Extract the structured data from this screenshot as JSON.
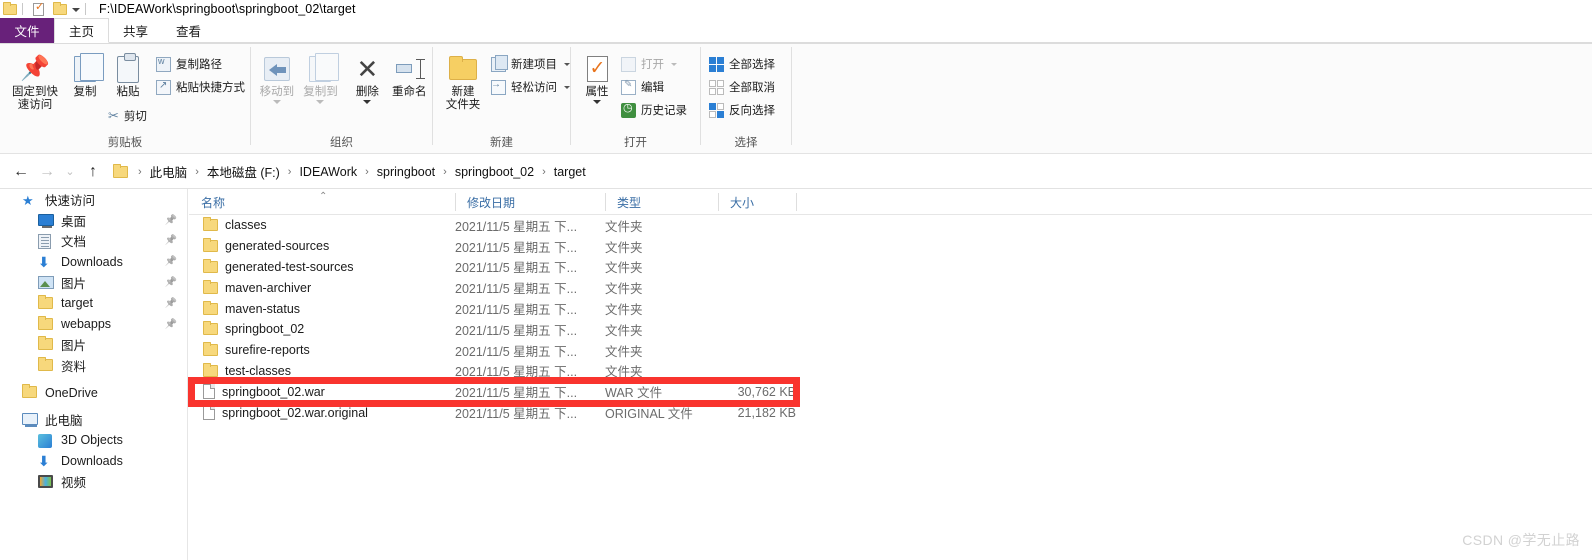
{
  "window": {
    "title_path": "F:\\IDEAWork\\springboot\\springboot_02\\target",
    "quick_access": [
      {
        "name": "folder-icon",
        "label": ""
      },
      {
        "name": "properties-icon",
        "label": ""
      },
      {
        "name": "new-folder-icon",
        "label": ""
      },
      {
        "name": "customize-qat-caret",
        "label": ""
      }
    ]
  },
  "tabs": [
    {
      "id": "file",
      "label": "文件"
    },
    {
      "id": "home",
      "label": "主页"
    },
    {
      "id": "share",
      "label": "共享"
    },
    {
      "id": "view",
      "label": "查看"
    }
  ],
  "ribbon": {
    "groups": [
      {
        "id": "clipboard",
        "label": "剪贴板",
        "big": [
          {
            "label": "固定到快\n速访问",
            "line1": "固定到快",
            "line2": "速访问",
            "icon": "pin-icon",
            "disabled": false
          },
          {
            "label": "复制",
            "line1": "复制",
            "line2": "",
            "icon": "copy-icon",
            "disabled": false
          },
          {
            "label": "粘贴",
            "line1": "粘贴",
            "line2": "",
            "icon": "paste-icon",
            "disabled": false
          }
        ],
        "small": [
          {
            "label": "复制路径",
            "icon": "copy-path-icon"
          },
          {
            "label": "粘贴快捷方式",
            "icon": "paste-shortcut-icon"
          },
          {
            "label": "剪切",
            "icon": "scissors-icon"
          }
        ]
      },
      {
        "id": "organize",
        "label": "组织",
        "big": [
          {
            "line1": "移动到",
            "line2": "",
            "icon": "move-to-icon",
            "disabled": true
          },
          {
            "line1": "复制到",
            "line2": "",
            "icon": "copy-to-icon",
            "disabled": true
          },
          {
            "line1": "删除",
            "line2": "",
            "icon": "delete-icon",
            "disabled": false
          },
          {
            "line1": "重命名",
            "line2": "",
            "icon": "rename-icon",
            "disabled": false
          }
        ]
      },
      {
        "id": "new",
        "label": "新建",
        "big": [
          {
            "line1": "新建",
            "line2": "文件夹",
            "icon": "new-folder-icon",
            "disabled": false
          }
        ],
        "small": [
          {
            "label": "新建项目",
            "icon": "new-item-icon"
          },
          {
            "label": "轻松访问",
            "icon": "easy-access-icon"
          }
        ]
      },
      {
        "id": "open",
        "label": "打开",
        "big": [
          {
            "line1": "属性",
            "line2": "",
            "icon": "properties-icon",
            "disabled": false
          }
        ],
        "small": [
          {
            "label": "打开",
            "icon": "open-icon"
          },
          {
            "label": "编辑",
            "icon": "edit-icon"
          },
          {
            "label": "历史记录",
            "icon": "history-icon"
          }
        ]
      },
      {
        "id": "select",
        "label": "选择",
        "small": [
          {
            "label": "全部选择",
            "icon": "select-all-icon"
          },
          {
            "label": "全部取消",
            "icon": "select-none-icon"
          },
          {
            "label": "反向选择",
            "icon": "invert-selection-icon"
          }
        ]
      }
    ]
  },
  "address": {
    "back_icon": "back-arrow-icon",
    "forward_icon": "forward-arrow-icon",
    "recent_icon": "recent-locations-icon",
    "up_icon": "up-arrow-icon",
    "breadcrumbs": [
      "此电脑",
      "本地磁盘 (F:)",
      "IDEAWork",
      "springboot",
      "springboot_02",
      "target"
    ],
    "separator": "›"
  },
  "navpane": {
    "items": [
      {
        "label": "快速访问",
        "icon": "quick-access-star-icon",
        "level": 0,
        "pinned": false
      },
      {
        "label": "桌面",
        "icon": "desktop-icon",
        "level": 1,
        "pinned": true
      },
      {
        "label": "文档",
        "icon": "documents-icon",
        "level": 1,
        "pinned": true
      },
      {
        "label": "Downloads",
        "icon": "downloads-icon",
        "level": 1,
        "pinned": true
      },
      {
        "label": "图片",
        "icon": "pictures-icon",
        "level": 1,
        "pinned": true
      },
      {
        "label": "target",
        "icon": "folder-icon",
        "level": 1,
        "pinned": true
      },
      {
        "label": "webapps",
        "icon": "folder-icon",
        "level": 1,
        "pinned": true
      },
      {
        "label": "图片",
        "icon": "folder-icon",
        "level": 1,
        "pinned": false
      },
      {
        "label": "资料",
        "icon": "folder-icon",
        "level": 1,
        "pinned": false
      },
      {
        "label": "OneDrive",
        "icon": "onedrive-folder-icon",
        "level": 0,
        "pinned": false
      },
      {
        "label": "此电脑",
        "icon": "this-pc-icon",
        "level": 0,
        "pinned": false
      },
      {
        "label": "3D Objects",
        "icon": "3d-objects-icon",
        "level": 1,
        "pinned": false
      },
      {
        "label": "Downloads",
        "icon": "downloads-icon",
        "level": 1,
        "pinned": false
      },
      {
        "label": "视频",
        "icon": "videos-icon",
        "level": 1,
        "pinned": false
      }
    ]
  },
  "filelist": {
    "columns": [
      {
        "id": "name",
        "label": "名称",
        "sorted": true,
        "sort_dir": "asc"
      },
      {
        "id": "date",
        "label": "修改日期",
        "sorted": false,
        "sort_dir": ""
      },
      {
        "id": "type",
        "label": "类型",
        "sorted": false,
        "sort_dir": ""
      },
      {
        "id": "size",
        "label": "大小",
        "sorted": false,
        "sort_dir": ""
      }
    ],
    "rows": [
      {
        "name": "classes",
        "date": "2021/11/5 星期五 下...",
        "type": "文件夹",
        "size": "",
        "icon": "folder-icon",
        "highlighted": false
      },
      {
        "name": "generated-sources",
        "date": "2021/11/5 星期五 下...",
        "type": "文件夹",
        "size": "",
        "icon": "folder-icon",
        "highlighted": false
      },
      {
        "name": "generated-test-sources",
        "date": "2021/11/5 星期五 下...",
        "type": "文件夹",
        "size": "",
        "icon": "folder-icon",
        "highlighted": false
      },
      {
        "name": "maven-archiver",
        "date": "2021/11/5 星期五 下...",
        "type": "文件夹",
        "size": "",
        "icon": "folder-icon",
        "highlighted": false
      },
      {
        "name": "maven-status",
        "date": "2021/11/5 星期五 下...",
        "type": "文件夹",
        "size": "",
        "icon": "folder-icon",
        "highlighted": false
      },
      {
        "name": "springboot_02",
        "date": "2021/11/5 星期五 下...",
        "type": "文件夹",
        "size": "",
        "icon": "folder-icon",
        "highlighted": false
      },
      {
        "name": "surefire-reports",
        "date": "2021/11/5 星期五 下...",
        "type": "文件夹",
        "size": "",
        "icon": "folder-icon",
        "highlighted": false
      },
      {
        "name": "test-classes",
        "date": "2021/11/5 星期五 下...",
        "type": "文件夹",
        "size": "",
        "icon": "folder-icon",
        "highlighted": false
      },
      {
        "name": "springboot_02.war",
        "date": "2021/11/5 星期五 下...",
        "type": "WAR 文件",
        "size": "30,762 KB",
        "icon": "file-icon",
        "highlighted": true
      },
      {
        "name": "springboot_02.war.original",
        "date": "2021/11/5 星期五 下...",
        "type": "ORIGINAL 文件",
        "size": "21,182 KB",
        "icon": "file-icon",
        "highlighted": false
      }
    ]
  },
  "annotation": {
    "highlight_color": "#f9342e",
    "target_row": "springboot_02.war"
  },
  "watermark": {
    "text": "CSDN @学无止路",
    "color": "#d2d2d2"
  }
}
